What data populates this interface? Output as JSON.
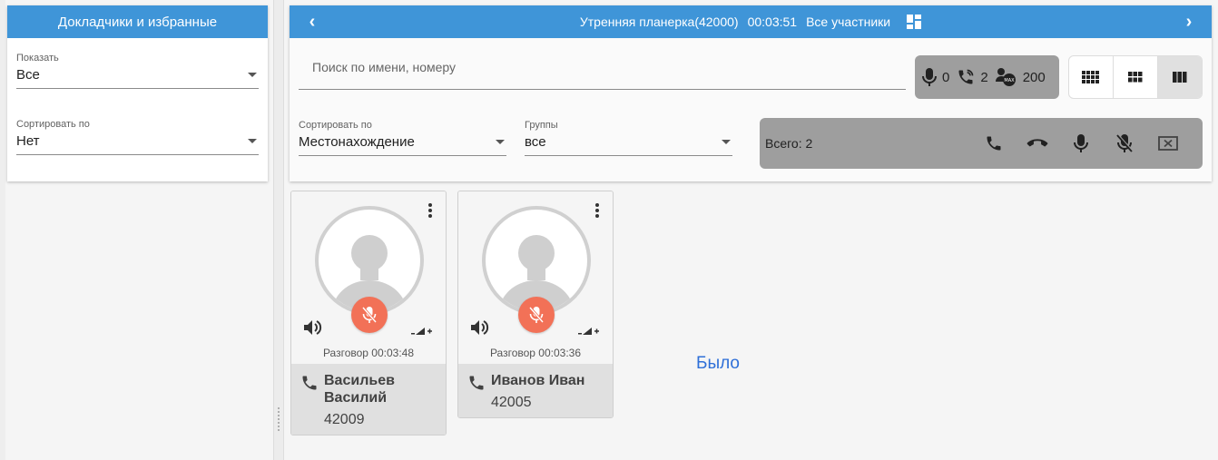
{
  "left_panel": {
    "title": "Докладчики и избранные",
    "show": {
      "label": "Показать",
      "value": "Все"
    },
    "sort": {
      "label": "Сортировать по",
      "value": "Нет"
    }
  },
  "header": {
    "title": "Утренняя планерка(42000)",
    "timer": "00:03:51",
    "filter": "Все участники"
  },
  "search": {
    "placeholder": "Поиск по имени, номеру"
  },
  "stats": {
    "muted": "0",
    "calls": "2",
    "max": "200"
  },
  "sort": {
    "label": "Сортировать по",
    "value": "Местонахождение"
  },
  "groups": {
    "label": "Группы",
    "value": "все"
  },
  "actions": {
    "total": "Всего: 2"
  },
  "participants": [
    {
      "name": "Васильев Василий",
      "number": "42009",
      "talk": "Разговор 00:03:48"
    },
    {
      "name": "Иванов Иван",
      "number": "42005",
      "talk": "Разговор 00:03:36"
    }
  ],
  "note": "Было",
  "colors": {
    "header": "#3f95d8",
    "mute": "#f27157",
    "accent_text": "#2e6fd8"
  }
}
